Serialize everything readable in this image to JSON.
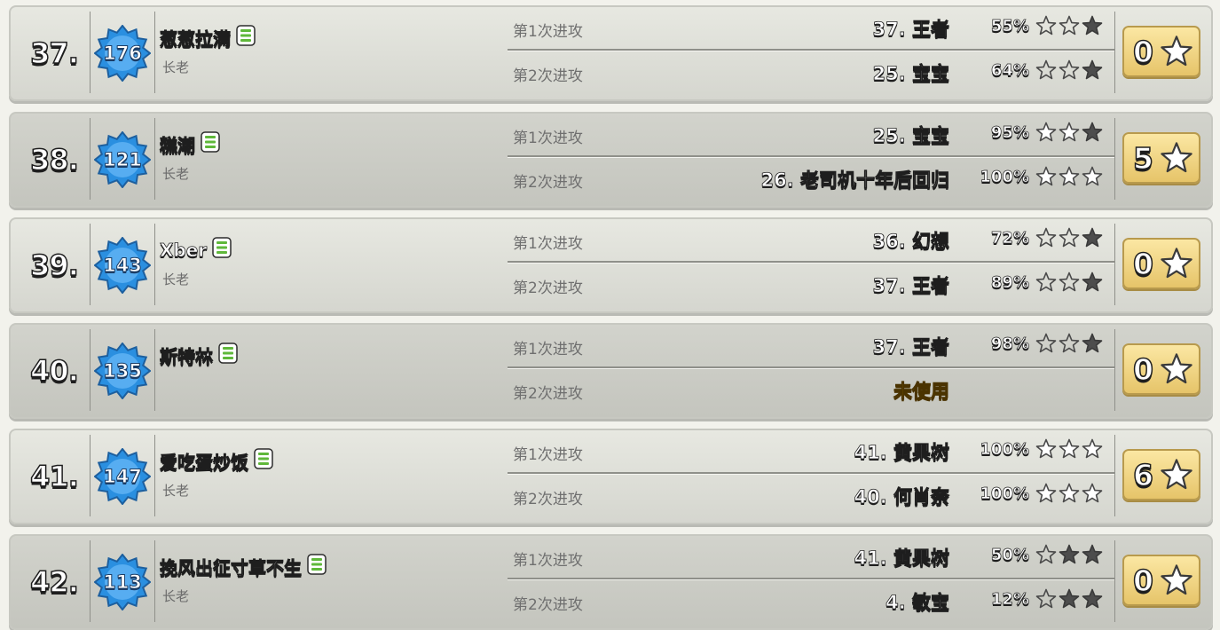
{
  "colors": {
    "badge_blue": "#2a8fe0",
    "badge_light": "#7cc7ff",
    "unused_text": "#f7b800",
    "star_earned_fill": "#ffffff",
    "star_destroyed_fill": "#4d4d4d",
    "total_box": "#f3d88a"
  },
  "icons": {
    "member_list_icon": "green-list-icon",
    "town_badge": "blue-star-badge",
    "attack_star": "star-icon"
  },
  "members": [
    {
      "rank": "37.",
      "level": "176",
      "name": "葱葱拉满",
      "role": "长老",
      "attacks": [
        {
          "label": "第1次进攻",
          "target": "37. 王者",
          "percent": "55%",
          "stars": [
            "empty",
            "empty",
            "destroyed"
          ]
        },
        {
          "label": "第2次进攻",
          "target": "25. 宝宝",
          "percent": "64%",
          "stars": [
            "empty",
            "empty",
            "destroyed"
          ]
        }
      ],
      "total_stars": "0"
    },
    {
      "rank": "38.",
      "level": "121",
      "name": "糕潮",
      "role": "长老",
      "attacks": [
        {
          "label": "第1次进攻",
          "target": "25. 宝宝",
          "percent": "95%",
          "stars": [
            "earned",
            "earned",
            "destroyed"
          ]
        },
        {
          "label": "第2次进攻",
          "target": "26. 老司机十年后回归",
          "percent": "100%",
          "stars": [
            "earned",
            "earned",
            "earned"
          ]
        }
      ],
      "total_stars": "5"
    },
    {
      "rank": "39.",
      "level": "143",
      "name": "Xber",
      "role": "长老",
      "attacks": [
        {
          "label": "第1次进攻",
          "target": "36. 幻想",
          "percent": "72%",
          "stars": [
            "empty",
            "empty",
            "destroyed"
          ]
        },
        {
          "label": "第2次进攻",
          "target": "37. 王者",
          "percent": "89%",
          "stars": [
            "empty",
            "empty",
            "destroyed"
          ]
        }
      ],
      "total_stars": "0"
    },
    {
      "rank": "40.",
      "level": "135",
      "name": "斯特林",
      "role": "",
      "attacks": [
        {
          "label": "第1次进攻",
          "target": "37. 王者",
          "percent": "98%",
          "stars": [
            "empty",
            "empty",
            "destroyed"
          ]
        },
        {
          "label": "第2次进攻",
          "target": "未使用",
          "percent": "",
          "stars": [],
          "unused": true
        }
      ],
      "total_stars": "0"
    },
    {
      "rank": "41.",
      "level": "147",
      "name": "爱吃蛋炒饭",
      "role": "长老",
      "attacks": [
        {
          "label": "第1次进攻",
          "target": "41. 黄果树",
          "percent": "100%",
          "stars": [
            "earned",
            "earned",
            "earned"
          ]
        },
        {
          "label": "第2次进攻",
          "target": "40. 何肖奈",
          "percent": "100%",
          "stars": [
            "earned",
            "earned",
            "earned"
          ]
        }
      ],
      "total_stars": "6"
    },
    {
      "rank": "42.",
      "level": "113",
      "name": "挽风出征寸草不生",
      "role": "长老",
      "attacks": [
        {
          "label": "第1次进攻",
          "target": "41. 黄果树",
          "percent": "50%",
          "stars": [
            "empty",
            "destroyed",
            "destroyed"
          ]
        },
        {
          "label": "第2次进攻",
          "target": "4. 敏宝",
          "percent": "12%",
          "stars": [
            "empty",
            "destroyed",
            "destroyed"
          ]
        }
      ],
      "total_stars": "0"
    }
  ]
}
